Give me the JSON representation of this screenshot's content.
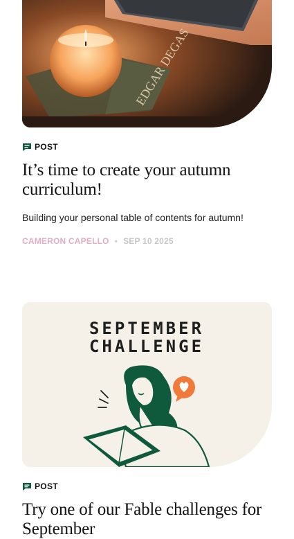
{
  "posts": [
    {
      "type": "POST",
      "title": "It’s time to create your autumn curriculum!",
      "excerpt": "Building your personal table of contents for autumn!",
      "author": "CAMERON CAPELLO",
      "date": "SEP 10 2025",
      "image_book_text": "EDGAR DEGAS"
    },
    {
      "type": "POST",
      "title": "Try one of our Fable challenges for September",
      "image_heading_line1": "SEPTEMBER",
      "image_heading_line2": "CHALLENGE"
    }
  ],
  "colors": {
    "author": "#e3aebe",
    "date": "#c6c6c6",
    "illustration_green": "#0f5a3c",
    "heart_badge": "#f07a3a",
    "card_bg": "#f5f1e8"
  },
  "icons": {
    "post_type": "chat-bubble-icon"
  }
}
